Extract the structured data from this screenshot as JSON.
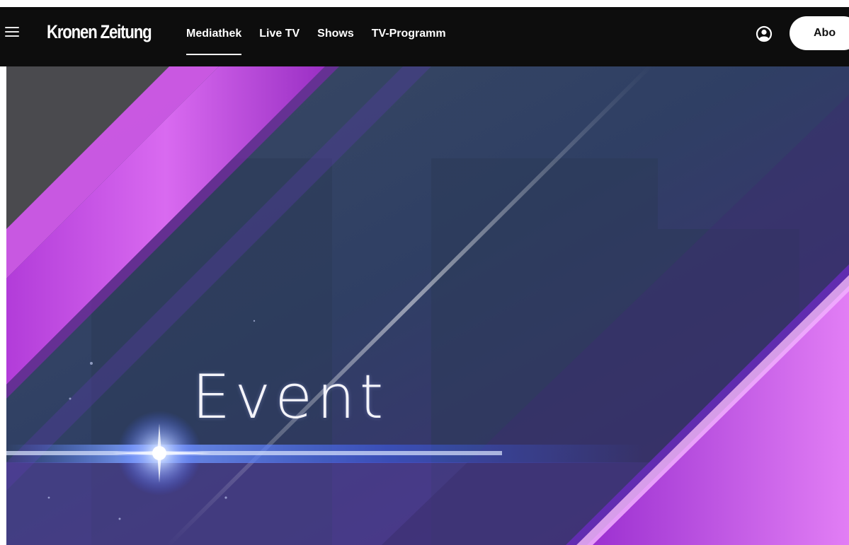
{
  "header": {
    "logo": "Kronen Zeitung",
    "nav": [
      {
        "label": "Mediathek",
        "active": true
      },
      {
        "label": "Live TV",
        "active": false
      },
      {
        "label": "Shows",
        "active": false
      },
      {
        "label": "TV-Programm",
        "active": false
      }
    ],
    "subscribe_label": "Abo",
    "icons": {
      "menu": "hamburger-menu-icon",
      "profile": "user-circle-icon"
    }
  },
  "hero": {
    "title": "Event"
  },
  "colors": {
    "header_bg": "#0d0d0d",
    "accent_magenta": "#c44ae6",
    "hero_blue": "#2e3a66"
  }
}
